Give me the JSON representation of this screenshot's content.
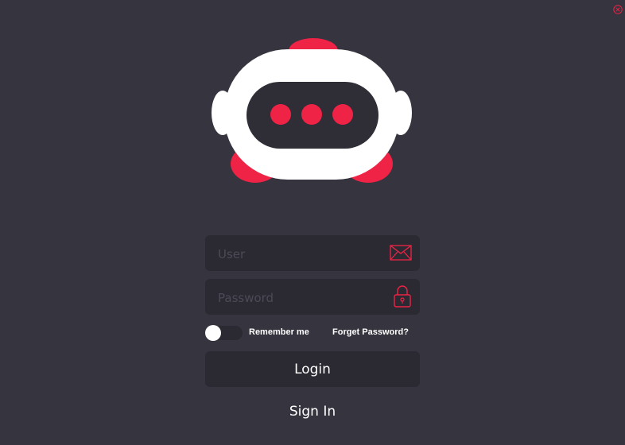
{
  "window": {
    "close_icon": "close-circle-icon"
  },
  "colors": {
    "background": "#36343f",
    "field_bg": "#2b2a33",
    "accent": "#ee2345",
    "text": "#ffffff",
    "placeholder": "#4c4a55"
  },
  "logo": {
    "icon": "robot-icon"
  },
  "form": {
    "user_placeholder": "User",
    "user_icon": "envelope-icon",
    "password_placeholder": "Password",
    "password_icon": "lock-icon",
    "remember_label": "Remember me",
    "remember_checked": false,
    "forgot_label": "Forget Password?",
    "login_label": "Login",
    "signin_label": "Sign In"
  }
}
